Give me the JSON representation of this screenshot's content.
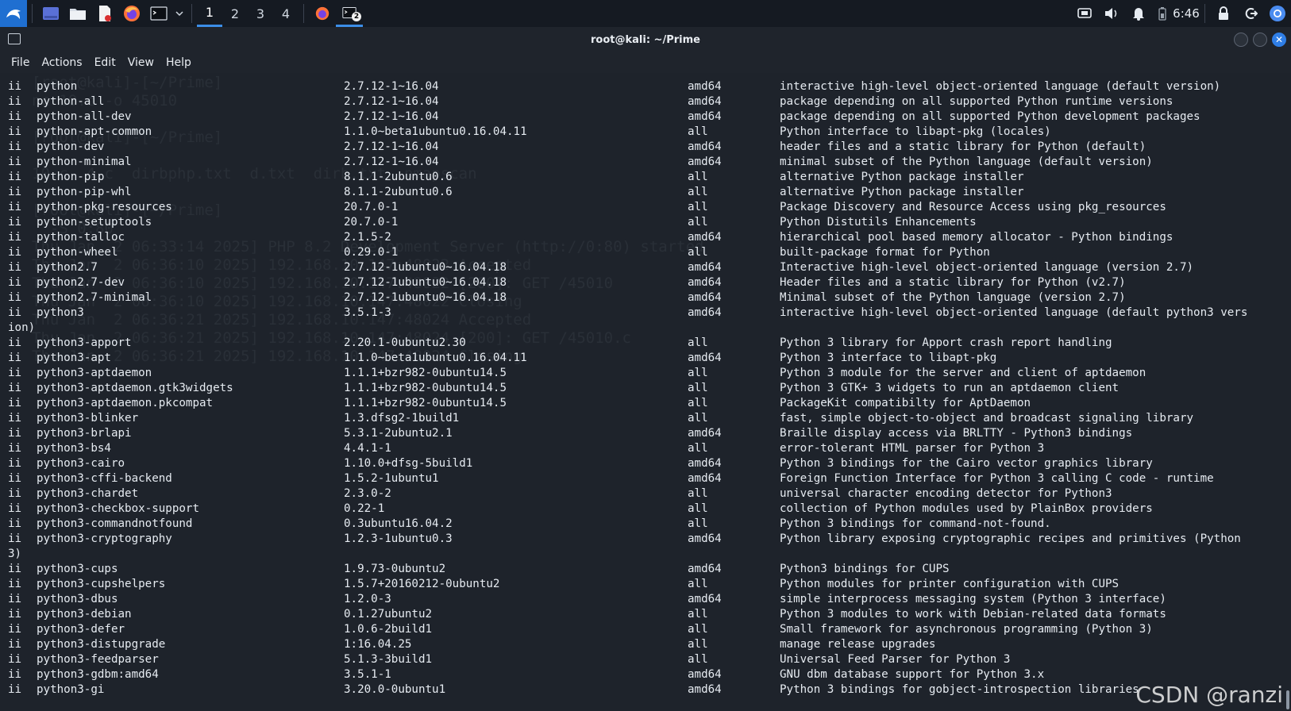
{
  "taskbar": {
    "workspaces": [
      "1",
      "2",
      "3",
      "4"
    ],
    "active_workspace": "1",
    "clock": "6:46",
    "terminal_badge": "2",
    "icons": [
      "kali-menu-icon",
      "desktop-icon",
      "file-manager-icon",
      "text-editor-icon",
      "firefox-icon",
      "terminal-icon",
      "chevron-down-icon"
    ],
    "accent": "#3c8ee8"
  },
  "window": {
    "title": "root@kali: ~/Prime",
    "menu": [
      "File",
      "Actions",
      "Edit",
      "View",
      "Help"
    ]
  },
  "terminal": {
    "background": "#1e232b",
    "ghost_lines": [
      "[root@kali]-[~/Prime]",
      "nc 10.c -o 45010",
      "",
      "[root@kali]-[~/Prime]",
      "",
      "10.c  4.c  dirbphp.txt  d.txt  dirb.txt  nmapscan",
      "",
      "[root@kali]-[~/Prime]",
      "  -S 0:80",
      "Thu Jan  2 06:33:14 2025] PHP 8.2 Development Server (http://0:80) started",
      "Thu Jan  2 06:36:10 2025] 192.168.10.147:48022 Accepted",
      "Thu Jan  2 06:36:10 2025] 192.168.10.147:48022 [200]: GET /45010",
      "Thu Jan  2 06:36:10 2025] 192.168.10.147:48022 Closing",
      "Thu Jan  2 06:36:21 2025] 192.168.10.147:48024 Accepted",
      "Thu Jan  2 06:36:21 2025] 192.168.10.147:48024 [200]: GET /45010.c",
      "Thu Jan  2 06:36:21 2025] 192.168.10.147:48024 Closing"
    ],
    "packages": [
      {
        "status": "ii",
        "name": "python",
        "version": "2.7.12-1~16.04",
        "arch": "amd64",
        "desc": "interactive high-level object-oriented language (default version)"
      },
      {
        "status": "ii",
        "name": "python-all",
        "version": "2.7.12-1~16.04",
        "arch": "amd64",
        "desc": "package depending on all supported Python runtime versions"
      },
      {
        "status": "ii",
        "name": "python-all-dev",
        "version": "2.7.12-1~16.04",
        "arch": "amd64",
        "desc": "package depending on all supported Python development packages"
      },
      {
        "status": "ii",
        "name": "python-apt-common",
        "version": "1.1.0~beta1ubuntu0.16.04.11",
        "arch": "all",
        "desc": "Python interface to libapt-pkg (locales)"
      },
      {
        "status": "ii",
        "name": "python-dev",
        "version": "2.7.12-1~16.04",
        "arch": "amd64",
        "desc": "header files and a static library for Python (default)"
      },
      {
        "status": "ii",
        "name": "python-minimal",
        "version": "2.7.12-1~16.04",
        "arch": "amd64",
        "desc": "minimal subset of the Python language (default version)"
      },
      {
        "status": "ii",
        "name": "python-pip",
        "version": "8.1.1-2ubuntu0.6",
        "arch": "all",
        "desc": "alternative Python package installer"
      },
      {
        "status": "ii",
        "name": "python-pip-whl",
        "version": "8.1.1-2ubuntu0.6",
        "arch": "all",
        "desc": "alternative Python package installer"
      },
      {
        "status": "ii",
        "name": "python-pkg-resources",
        "version": "20.7.0-1",
        "arch": "all",
        "desc": "Package Discovery and Resource Access using pkg_resources"
      },
      {
        "status": "ii",
        "name": "python-setuptools",
        "version": "20.7.0-1",
        "arch": "all",
        "desc": "Python Distutils Enhancements"
      },
      {
        "status": "ii",
        "name": "python-talloc",
        "version": "2.1.5-2",
        "arch": "amd64",
        "desc": "hierarchical pool based memory allocator - Python bindings"
      },
      {
        "status": "ii",
        "name": "python-wheel",
        "version": "0.29.0-1",
        "arch": "all",
        "desc": "built-package format for Python"
      },
      {
        "status": "ii",
        "name": "python2.7",
        "version": "2.7.12-1ubuntu0~16.04.18",
        "arch": "amd64",
        "desc": "Interactive high-level object-oriented language (version 2.7)"
      },
      {
        "status": "ii",
        "name": "python2.7-dev",
        "version": "2.7.12-1ubuntu0~16.04.18",
        "arch": "amd64",
        "desc": "Header files and a static library for Python (v2.7)"
      },
      {
        "status": "ii",
        "name": "python2.7-minimal",
        "version": "2.7.12-1ubuntu0~16.04.18",
        "arch": "amd64",
        "desc": "Minimal subset of the Python language (version 2.7)"
      },
      {
        "status": "ii",
        "name": "python3",
        "version": "3.5.1-3",
        "arch": "amd64",
        "desc": "interactive high-level object-oriented language (default python3 vers",
        "wrap": "ion)"
      },
      {
        "status": "ii",
        "name": "python3-apport",
        "version": "2.20.1-0ubuntu2.30",
        "arch": "all",
        "desc": "Python 3 library for Apport crash report handling"
      },
      {
        "status": "ii",
        "name": "python3-apt",
        "version": "1.1.0~beta1ubuntu0.16.04.11",
        "arch": "amd64",
        "desc": "Python 3 interface to libapt-pkg"
      },
      {
        "status": "ii",
        "name": "python3-aptdaemon",
        "version": "1.1.1+bzr982-0ubuntu14.5",
        "arch": "all",
        "desc": "Python 3 module for the server and client of aptdaemon"
      },
      {
        "status": "ii",
        "name": "python3-aptdaemon.gtk3widgets",
        "version": "1.1.1+bzr982-0ubuntu14.5",
        "arch": "all",
        "desc": "Python 3 GTK+ 3 widgets to run an aptdaemon client"
      },
      {
        "status": "ii",
        "name": "python3-aptdaemon.pkcompat",
        "version": "1.1.1+bzr982-0ubuntu14.5",
        "arch": "all",
        "desc": "PackageKit compatibilty for AptDaemon"
      },
      {
        "status": "ii",
        "name": "python3-blinker",
        "version": "1.3.dfsg2-1build1",
        "arch": "all",
        "desc": "fast, simple object-to-object and broadcast signaling library"
      },
      {
        "status": "ii",
        "name": "python3-brlapi",
        "version": "5.3.1-2ubuntu2.1",
        "arch": "amd64",
        "desc": "Braille display access via BRLTTY - Python3 bindings"
      },
      {
        "status": "ii",
        "name": "python3-bs4",
        "version": "4.4.1-1",
        "arch": "all",
        "desc": "error-tolerant HTML parser for Python 3"
      },
      {
        "status": "ii",
        "name": "python3-cairo",
        "version": "1.10.0+dfsg-5build1",
        "arch": "amd64",
        "desc": "Python 3 bindings for the Cairo vector graphics library"
      },
      {
        "status": "ii",
        "name": "python3-cffi-backend",
        "version": "1.5.2-1ubuntu1",
        "arch": "amd64",
        "desc": "Foreign Function Interface for Python 3 calling C code - runtime"
      },
      {
        "status": "ii",
        "name": "python3-chardet",
        "version": "2.3.0-2",
        "arch": "all",
        "desc": "universal character encoding detector for Python3"
      },
      {
        "status": "ii",
        "name": "python3-checkbox-support",
        "version": "0.22-1",
        "arch": "all",
        "desc": "collection of Python modules used by PlainBox providers"
      },
      {
        "status": "ii",
        "name": "python3-commandnotfound",
        "version": "0.3ubuntu16.04.2",
        "arch": "all",
        "desc": "Python 3 bindings for command-not-found."
      },
      {
        "status": "ii",
        "name": "python3-cryptography",
        "version": "1.2.3-1ubuntu0.3",
        "arch": "amd64",
        "desc": "Python library exposing cryptographic recipes and primitives (Python",
        "wrap": "3)"
      },
      {
        "status": "ii",
        "name": "python3-cups",
        "version": "1.9.73-0ubuntu2",
        "arch": "amd64",
        "desc": "Python3 bindings for CUPS"
      },
      {
        "status": "ii",
        "name": "python3-cupshelpers",
        "version": "1.5.7+20160212-0ubuntu2",
        "arch": "all",
        "desc": "Python modules for printer configuration with CUPS"
      },
      {
        "status": "ii",
        "name": "python3-dbus",
        "version": "1.2.0-3",
        "arch": "amd64",
        "desc": "simple interprocess messaging system (Python 3 interface)"
      },
      {
        "status": "ii",
        "name": "python3-debian",
        "version": "0.1.27ubuntu2",
        "arch": "all",
        "desc": "Python 3 modules to work with Debian-related data formats"
      },
      {
        "status": "ii",
        "name": "python3-defer",
        "version": "1.0.6-2build1",
        "arch": "all",
        "desc": "Small framework for asynchronous programming (Python 3)"
      },
      {
        "status": "ii",
        "name": "python3-distupgrade",
        "version": "1:16.04.25",
        "arch": "all",
        "desc": "manage release upgrades"
      },
      {
        "status": "ii",
        "name": "python3-feedparser",
        "version": "5.1.3-3build1",
        "arch": "all",
        "desc": "Universal Feed Parser for Python 3"
      },
      {
        "status": "ii",
        "name": "python3-gdbm:amd64",
        "version": "3.5.1-1",
        "arch": "amd64",
        "desc": "GNU dbm database support for Python 3.x"
      },
      {
        "status": "ii",
        "name": "python3-gi",
        "version": "3.20.0-0ubuntu1",
        "arch": "amd64",
        "desc": "Python 3 bindings for gobject-introspection libraries"
      }
    ]
  },
  "watermark": "CSDN @ranzi"
}
